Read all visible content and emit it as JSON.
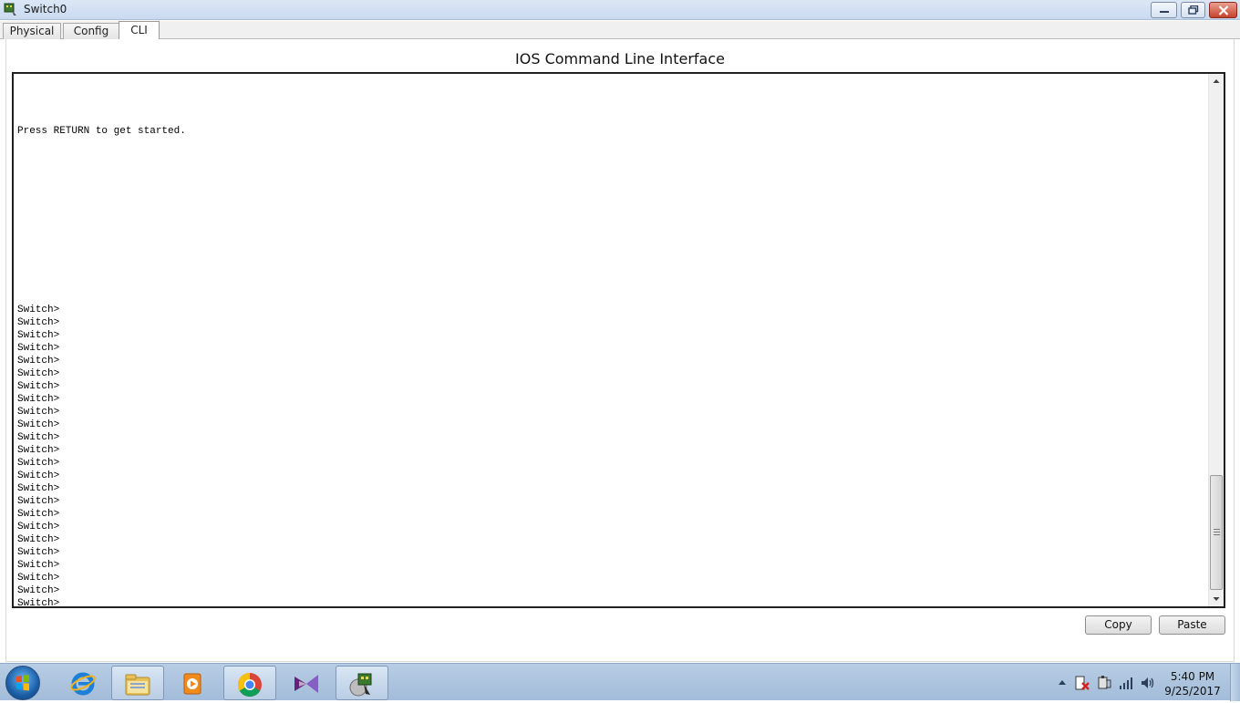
{
  "window": {
    "title": "Switch0",
    "minimize_label": "",
    "restore_label": "",
    "close_label": ""
  },
  "tabs": [
    {
      "label": "Physical"
    },
    {
      "label": "Config"
    },
    {
      "label": "CLI",
      "active": true
    }
  ],
  "panel": {
    "title": "IOS Command Line Interface"
  },
  "terminal": {
    "lines": [
      "",
      "",
      "",
      "",
      "Press RETURN to get started.",
      "",
      "",
      "",
      "",
      "",
      "",
      "",
      "",
      "",
      "",
      "",
      "",
      "",
      "Switch>",
      "Switch>",
      "Switch>",
      "Switch>",
      "Switch>",
      "Switch>",
      "Switch>",
      "Switch>",
      "Switch>",
      "Switch>",
      "Switch>",
      "Switch>",
      "Switch>",
      "Switch>",
      "Switch>",
      "Switch>",
      "Switch>",
      "Switch>",
      "Switch>",
      "Switch>",
      "Switch>",
      "Switch>",
      "Switch>",
      "Switch>"
    ]
  },
  "buttons": {
    "copy": "Copy",
    "paste": "Paste"
  },
  "taskbar": {
    "apps": [
      {
        "icon": "internet-explorer-icon"
      },
      {
        "icon": "file-explorer-icon",
        "active": true
      },
      {
        "icon": "media-player-icon"
      },
      {
        "icon": "chrome-icon",
        "active": true
      },
      {
        "icon": "visual-studio-icon"
      },
      {
        "icon": "packet-tracer-icon",
        "active": true
      }
    ],
    "clock": {
      "time": "5:40 PM",
      "date": "9/25/2017"
    }
  },
  "colors": {
    "titlebar": "#c9daf0",
    "taskbar": "#a3bcd9",
    "terminal_border": "#202020"
  }
}
